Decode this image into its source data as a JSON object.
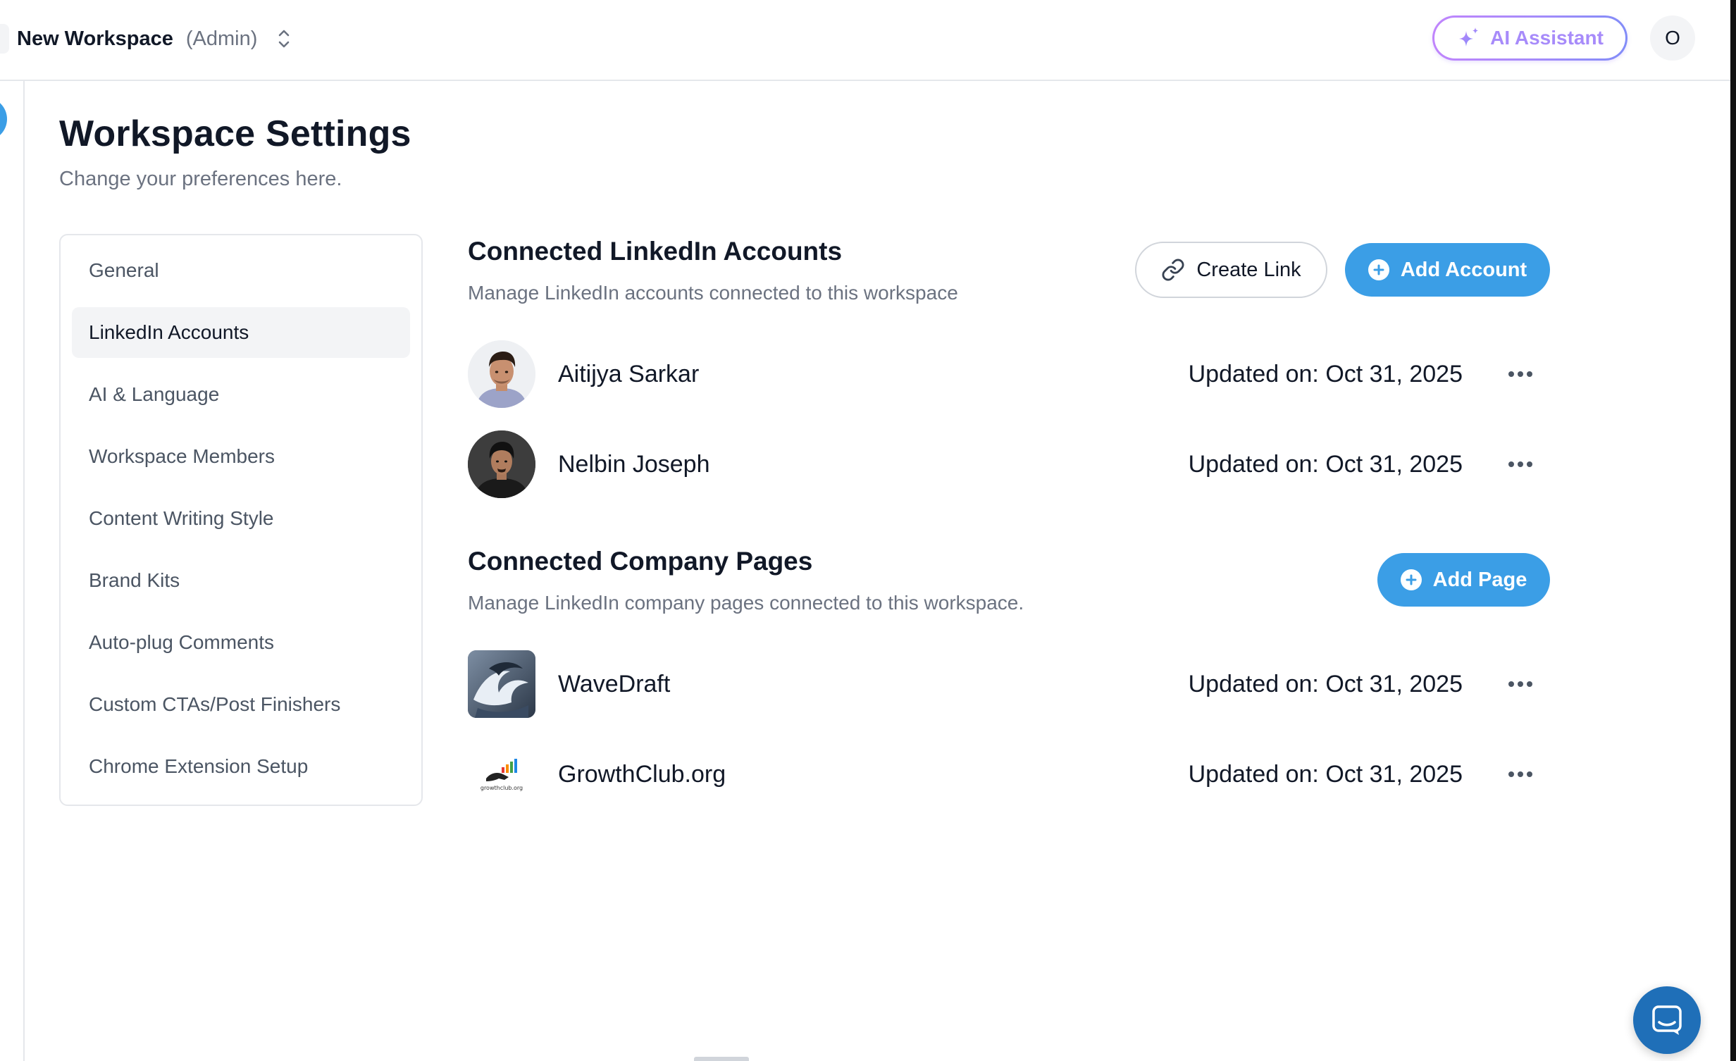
{
  "topbar": {
    "workspace_name": "New Workspace",
    "workspace_role": "(Admin)",
    "ai_assistant_label": "AI Assistant",
    "user_initial": "O"
  },
  "page": {
    "title": "Workspace Settings",
    "subtitle": "Change your preferences here."
  },
  "settings_nav": {
    "items": [
      {
        "label": "General",
        "active": false
      },
      {
        "label": "LinkedIn Accounts",
        "active": true
      },
      {
        "label": "AI & Language",
        "active": false
      },
      {
        "label": "Workspace Members",
        "active": false
      },
      {
        "label": "Content Writing Style",
        "active": false
      },
      {
        "label": "Brand Kits",
        "active": false
      },
      {
        "label": "Auto-plug Comments",
        "active": false
      },
      {
        "label": "Custom CTAs/Post Finishers",
        "active": false
      },
      {
        "label": "Chrome Extension Setup",
        "active": false
      }
    ]
  },
  "linkedin_accounts": {
    "title": "Connected LinkedIn Accounts",
    "subtitle": "Manage LinkedIn accounts connected to this workspace",
    "create_link_label": "Create Link",
    "add_account_label": "Add Account",
    "accounts": [
      {
        "name": "Aitijya Sarkar",
        "updated": "Updated on: Oct 31, 2025"
      },
      {
        "name": "Nelbin Joseph",
        "updated": "Updated on: Oct 31, 2025"
      }
    ]
  },
  "company_pages": {
    "title": "Connected Company Pages",
    "subtitle": "Manage LinkedIn company pages connected to this workspace.",
    "add_page_label": "Add Page",
    "pages": [
      {
        "name": "WaveDraft",
        "updated": "Updated on: Oct 31, 2025"
      },
      {
        "name": "GrowthClub.org",
        "updated": "Updated on: Oct 31, 2025",
        "logo_text": "growthclub.org"
      }
    ]
  },
  "colors": {
    "primary": "#3b9ee6",
    "ai_gradient_start": "#c084fc",
    "ai_gradient_end": "#818cf8",
    "chat_button": "#1f6fb8"
  },
  "icons": {
    "workspace_switch": "chevron-up-down-icon",
    "ai_assistant": "sparkles-icon",
    "create_link": "link-icon",
    "add": "plus-circle-icon",
    "row_menu": "more-horizontal-icon",
    "chat": "chat-bubble-icon"
  }
}
